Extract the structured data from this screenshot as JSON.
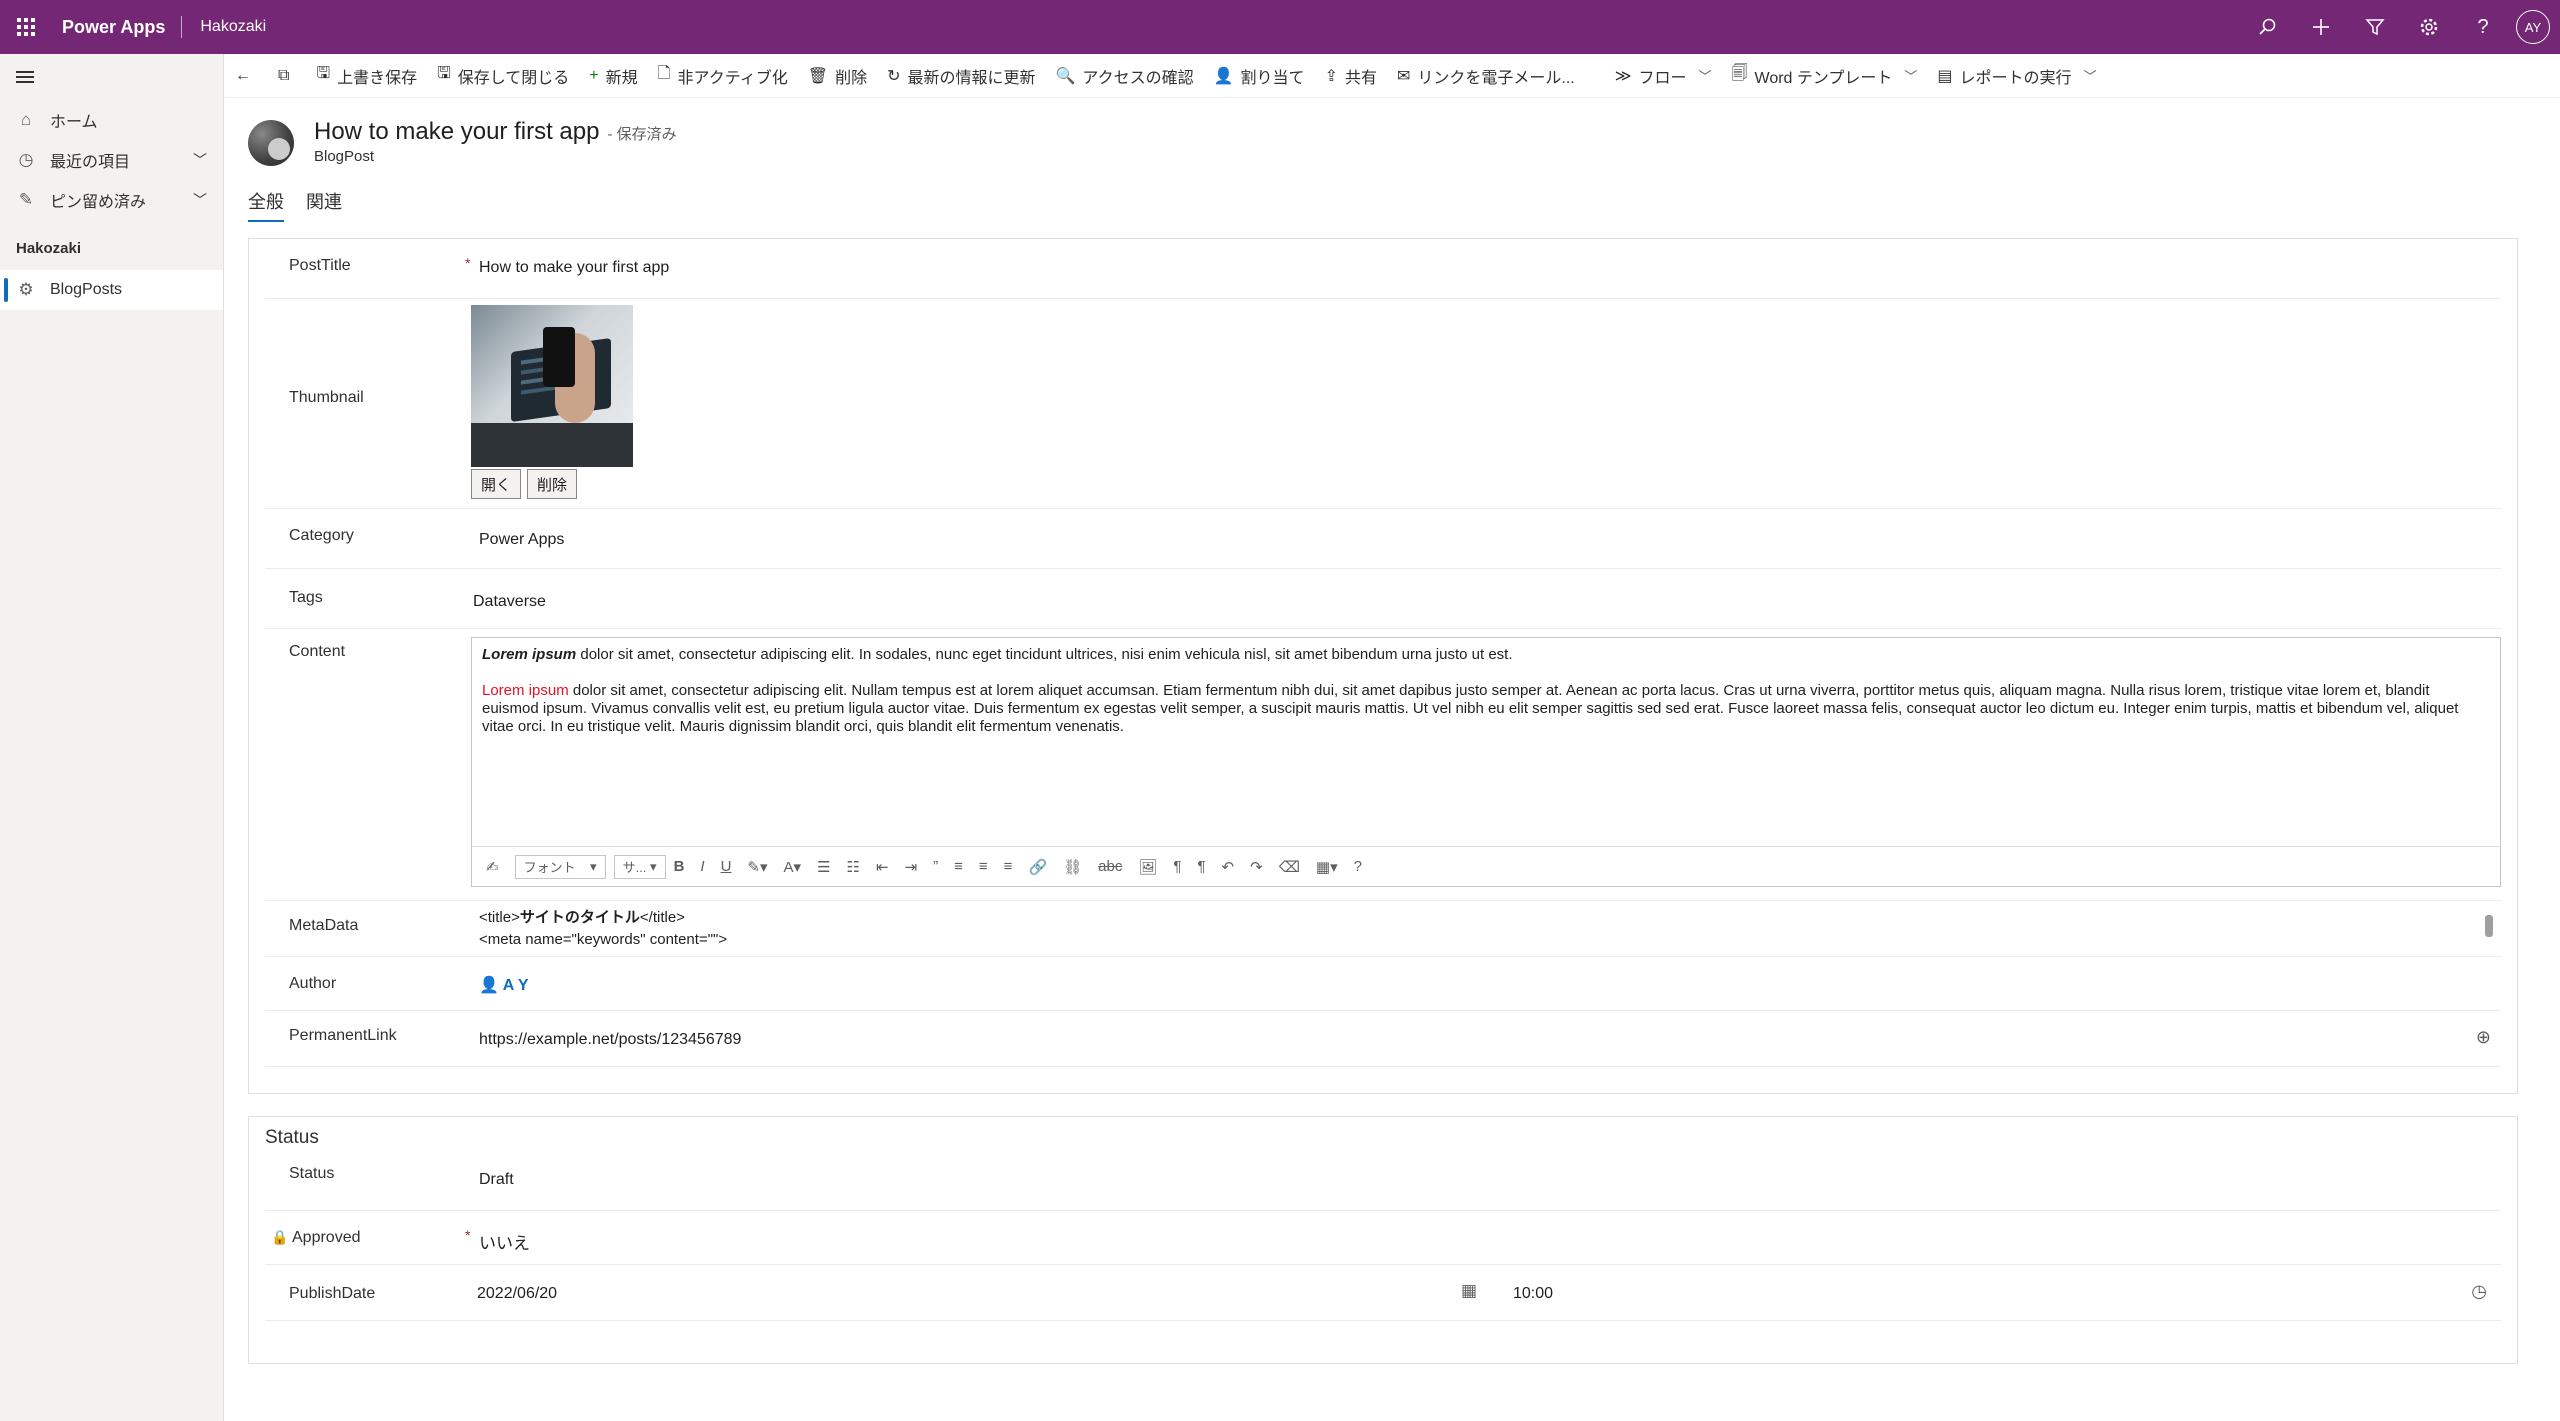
{
  "topbar": {
    "app_name": "Power Apps",
    "environment": "Hakozaki",
    "icons": [
      "search-icon",
      "plus-icon",
      "filter-icon",
      "gear-icon",
      "help-icon"
    ],
    "avatar_initials": "AY",
    "bg_color": "#742774"
  },
  "nav": {
    "items": [
      {
        "label": "ホーム",
        "icon": "home-icon"
      },
      {
        "label": "最近の項目",
        "icon": "clock-icon"
      },
      {
        "label": "ピン留め済み",
        "icon": "pin-icon"
      }
    ],
    "group": "Hakozaki",
    "selected_item": {
      "label": "BlogPosts",
      "icon": "puzzle-icon"
    }
  },
  "commands": [
    {
      "label": "上書き保存",
      "icon": "save-icon"
    },
    {
      "label": "保存して閉じる",
      "icon": "save-close-icon"
    },
    {
      "label": "新規",
      "icon": "plus-icon"
    },
    {
      "label": "非アクティブ化",
      "icon": "deactivate-icon"
    },
    {
      "label": "削除",
      "icon": "trash-icon"
    },
    {
      "label": "最新の情報に更新",
      "icon": "refresh-icon"
    },
    {
      "label": "アクセスの確認",
      "icon": "check-access-icon"
    },
    {
      "label": "割り当て",
      "icon": "assign-icon"
    },
    {
      "label": "共有",
      "icon": "share-icon"
    },
    {
      "label": "リンクを電子メール...",
      "icon": "email-link-icon"
    },
    {
      "label": "フロー",
      "icon": "flow-icon"
    },
    {
      "label": "Word テンプレート",
      "icon": "word-icon"
    },
    {
      "label": "レポートの実行",
      "icon": "report-icon"
    }
  ],
  "record": {
    "title": "How to make your first app",
    "saved_status": "- 保存済み",
    "entity": "BlogPost"
  },
  "tabs": [
    {
      "label": "全般",
      "active": true
    },
    {
      "label": "関連",
      "active": false
    }
  ],
  "fields": {
    "post_title": {
      "label": "PostTitle",
      "value": "How to make your first app",
      "required": "*"
    },
    "thumbnail": {
      "label": "Thumbnail",
      "open_label": "開く",
      "delete_label": "削除"
    },
    "category": {
      "label": "Category",
      "value": "Power Apps"
    },
    "tags": {
      "label": "Tags",
      "value": "Dataverse"
    },
    "content": {
      "label": "Content",
      "p1_bold": "Lorem ipsum",
      "p1_rest": " dolor sit amet, consectetur adipiscing elit. In sodales, nunc eget tincidunt ultrices, nisi enim vehicula nisl, sit amet bibendum urna justo ut est.",
      "p2_red": "Lorem ipsum",
      "p2_rest": " dolor sit amet, consectetur adipiscing elit. Nullam tempus est at lorem aliquet accumsan. Etiam fermentum nibh dui, sit amet dapibus justo semper at. Aenean ac porta lacus. Cras ut urna viverra, porttitor metus quis, aliquam magna. Nulla risus lorem, tristique vitae lorem et, blandit euismod ipsum. Vivamus convallis velit est, eu pretium ligula auctor vitae. Duis fermentum ex egestas velit semper, a suscipit mauris mattis. Ut vel nibh eu elit semper sagittis sed sed erat. Fusce laoreet massa felis, consequat auctor leo dictum eu. Integer enim turpis, mattis et bibendum vel, aliquet vitae orci. In eu tristique velit. Mauris dignissim blandit orci, quis blandit elit fermentum venenatis.",
      "red_color": "#e81123",
      "toolbar": {
        "font_label": "フォント",
        "size_label": "サ..."
      }
    },
    "metadata": {
      "label": "MetaData",
      "line1_pre": "<title>",
      "line1_bold": "サイトのタイトル",
      "line1_post": "</title>",
      "line2": "<meta name=\"keywords\" content=\"\">"
    },
    "author": {
      "label": "Author",
      "value": "A Y"
    },
    "permanent_link": {
      "label": "PermanentLink",
      "value": "https://example.net/posts/123456789"
    }
  },
  "status_section": {
    "title": "Status",
    "status": {
      "label": "Status",
      "value": "Draft"
    },
    "approved": {
      "label": "Approved",
      "value": "いいえ",
      "required": "*"
    },
    "publish_date": {
      "label": "PublishDate",
      "date": "2022/06/20",
      "time": "10:00"
    }
  }
}
